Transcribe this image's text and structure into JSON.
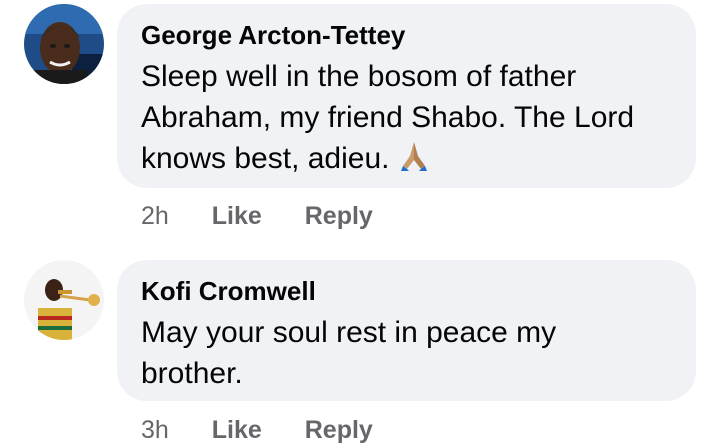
{
  "comments": [
    {
      "author": "George Arcton-Tettey",
      "text": "Sleep well in the bosom of father Abraham, my friend Shabo. The Lord knows best, adieu.",
      "emoji_icon": "praying-hands-icon",
      "time": "2h",
      "like_label": "Like",
      "reply_label": "Reply"
    },
    {
      "author": "Kofi Cromwell",
      "text": "May your soul rest in peace my brother.",
      "time": "3h",
      "like_label": "Like",
      "reply_label": "Reply"
    }
  ],
  "colors": {
    "bubble": "#f0f2f5",
    "author": "#050505",
    "meta": "#65676b"
  }
}
